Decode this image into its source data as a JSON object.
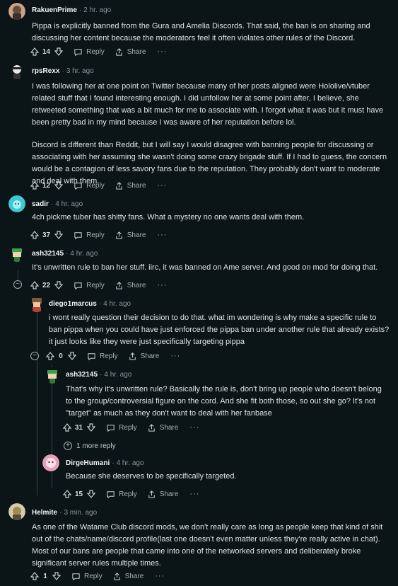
{
  "actions": {
    "reply_label": "Reply",
    "share_label": "Share",
    "more_label": "···"
  },
  "colors": {
    "background": "#0b1416",
    "thread_line": "#33464c",
    "meta": "#8a979d"
  },
  "comments": [
    {
      "author": "RakuenPrime",
      "time": "2 hr. ago",
      "votes": "14",
      "paragraphs": [
        "Pippa is explicitly banned from the Gura and Amelia Discords. That said, the ban is on sharing and discussing her content because the moderators feel it often violates other rules of the Discord."
      ]
    },
    {
      "author": "rpsRexx",
      "time": "3 hr. ago",
      "votes": "12",
      "paragraphs": [
        "I was following her at one point on Twitter because many of her posts aligned were Hololive/vtuber related stuff that I found interesting enough. I did unfollow her at some point after, I believe, she retweeted something that was a bit much for me to associate with. I forgot what it was but it must have been pretty bad in my mind because I was aware of her reputation before lol.",
        "Discord is different than Reddit, but I will say I would disagree with banning people for discussing or associating with her assuming she wasn't doing some crazy brigade stuff. If I had to guess, the concern would be a contagion of less savory fans due to the reputation. They probably don't want to moderate and deal with them."
      ]
    },
    {
      "author": "sadir",
      "time": "4 hr. ago",
      "votes": "37",
      "paragraphs": [
        "4ch pickme tuber has shitty fans. What a mystery no one wants deal with them."
      ]
    },
    {
      "author": "ash32145",
      "time": "4 hr. ago",
      "votes": "22",
      "paragraphs": [
        "It's unwritten rule to ban her stuff. iirc, it was banned on Ame server. And good on mod for doing that."
      ]
    },
    {
      "author": "diego1marcus",
      "time": "4 hr. ago",
      "votes": "0",
      "paragraphs": [
        "i wont really question their decision to do that. what im wondering is why make a specific rule to ban pippa when you could have just enforced the pippa ban under another rule that already exists? it just looks like they were just specifically targeting pippa"
      ]
    },
    {
      "author": "ash32145",
      "time": "4 hr. ago",
      "votes": "31",
      "paragraphs": [
        "That's why it's unwritten rule? Basically the rule is, don't bring up people who doesn't belong to the group/controversial figure on the cord. And she fit both those, so out she go? It's not \"target\" as much as they don't want to deal with her fanbase"
      ]
    },
    {
      "author": "DirgeHumani",
      "time": "4 hr. ago",
      "votes": "15",
      "paragraphs": [
        "Because she deserves to be specifically targeted."
      ]
    },
    {
      "author": "Helmite",
      "time": "3 min. ago",
      "votes": "1",
      "paragraphs": [
        "As one of the Watame Club discord mods, we don't really care as long as people keep that kind of shit out of the chats/name/discord profile(last one doesn't even matter unless they're really active in chat). Most of our bans are people that came into one of the networked servers and deliberately broke significant server rules multiple times."
      ]
    }
  ],
  "more_replies_label": "1 more reply"
}
